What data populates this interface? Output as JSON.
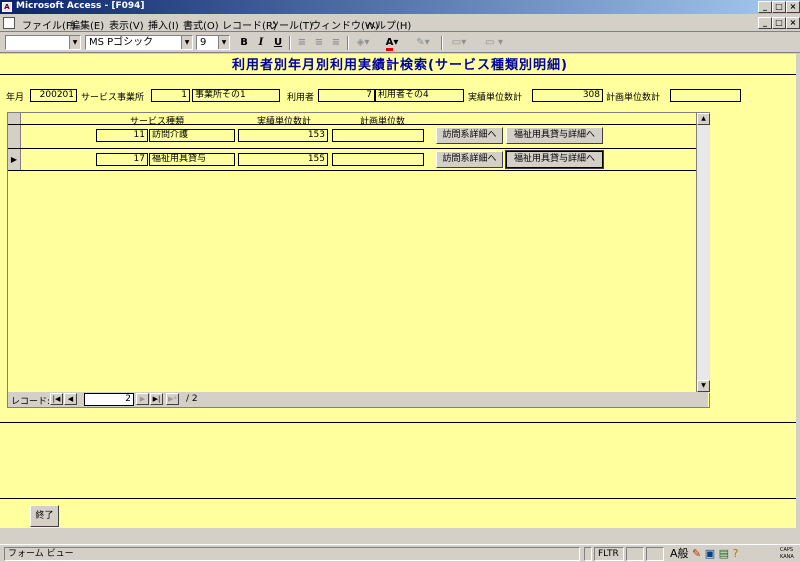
{
  "window": {
    "title": "Microsoft Access - [F094]",
    "min": "_",
    "max": "□",
    "close": "×"
  },
  "doc_controls": {
    "min": "_",
    "max": "□",
    "close": "×"
  },
  "menu": [
    "ファイル(F)",
    "編集(E)",
    "表示(V)",
    "挿入(I)",
    "書式(O)",
    "レコード(R)",
    "ツール(T)",
    "ウィンドウ(W)",
    "ヘルプ(H)"
  ],
  "toolbar": {
    "object_combo": "",
    "font": "MS Pゴシック",
    "size": "9",
    "bold": "B",
    "italic": "I",
    "underline": "U",
    "font_color_glyph": "A"
  },
  "form": {
    "title": "利用者別年月別利用実績計検索(サービス種類別明細)",
    "header": {
      "ym_label": "年月",
      "ym_value": "200201",
      "office_label": "サービス事業所",
      "office_id": "1",
      "office_name": "事業所その1",
      "user_label": "利用者",
      "user_id": "7",
      "user_name": "利用者その4",
      "actual_label": "実績単位数計",
      "actual_value": "308",
      "plan_label": "計画単位数計",
      "plan_value": ""
    },
    "columns": {
      "service": "サービス種類",
      "actual": "実績単位数計",
      "plan": "計画単位数"
    },
    "rows": [
      {
        "id": "11",
        "name": "訪問介護",
        "actual": "153",
        "plan": "",
        "btn1": "訪問系詳細へ",
        "btn2": "福祉用具貸与詳細へ"
      },
      {
        "id": "17",
        "name": "福祉用具貸与",
        "actual": "155",
        "plan": "",
        "btn1": "訪問系詳細へ",
        "btn2": "福祉用具貸与詳細へ"
      }
    ],
    "current_row": 1,
    "nav": {
      "label": "レコード:",
      "current": "2",
      "total": "/ 2"
    },
    "close_button": "終了"
  },
  "status": {
    "text": "フォーム ビュー",
    "filter": "FLTR",
    "ime_mode": "般",
    "caps": "CAPS",
    "kana": "KANA"
  }
}
